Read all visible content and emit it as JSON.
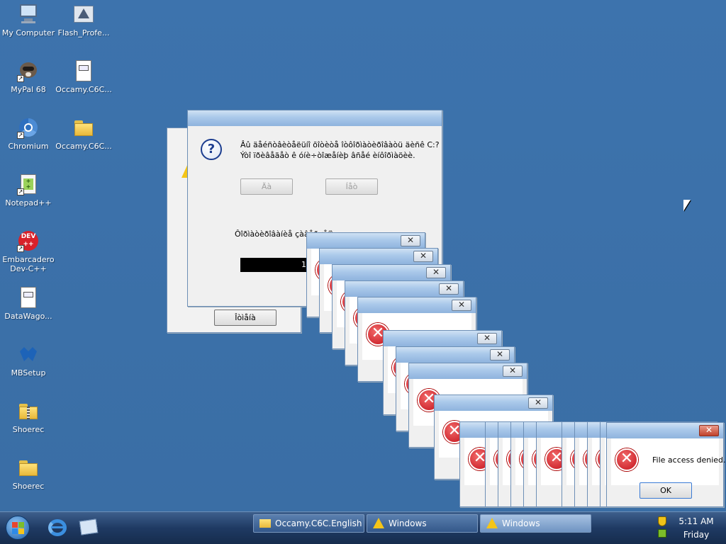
{
  "desktop_icons": [
    {
      "label": "My Computer"
    },
    {
      "label": "Flash_Profe..."
    },
    {
      "label": "MyPal 68"
    },
    {
      "label": "Occamy.C6C..."
    },
    {
      "label": "Chromium"
    },
    {
      "label": "Occamy.C6C..."
    },
    {
      "label": "Notepad++"
    },
    {
      "label": "Embarcadero\nDev-C++"
    },
    {
      "label": "DataWago..."
    },
    {
      "label": "MBSetup"
    },
    {
      "label": "Shoerec"
    },
    {
      "label": "Shoerec"
    }
  ],
  "icon_names": {
    "dev_badge": "DEV\n++",
    "pad_glyph": "+\n+"
  },
  "question_dialog": {
    "message_line1": "Âû äåéñòâèòåëüíî õîòèòå îòôîðìàòèðîâàòü äèñê C:?",
    "message_line2": "Ýòî ïðèâåäåò ê óíè÷òîæåíèþ âñåé èíôîðìàöèè.",
    "yes_label": "Äà",
    "no_label": "Íåò",
    "progress_label": "Ôîðìàòèðîâàíèå çàâåðøåíî",
    "progress_value": "1",
    "cancel_label": "Îòìåíà"
  },
  "error_dialog": {
    "message": "File access denied.",
    "ok_label": "OK",
    "close_glyph": "✕",
    "error_glyph": "✕"
  },
  "taskbar": {
    "buttons": [
      {
        "label": "Occamy.C6C.English"
      },
      {
        "label": "Windows"
      },
      {
        "label": "Windows"
      }
    ],
    "time": "5:11 AM",
    "day": "Friday"
  },
  "colors": {
    "desktop": "#3a6ea5",
    "error_red": "#c4121c",
    "taskbar": "#1f3a63"
  }
}
